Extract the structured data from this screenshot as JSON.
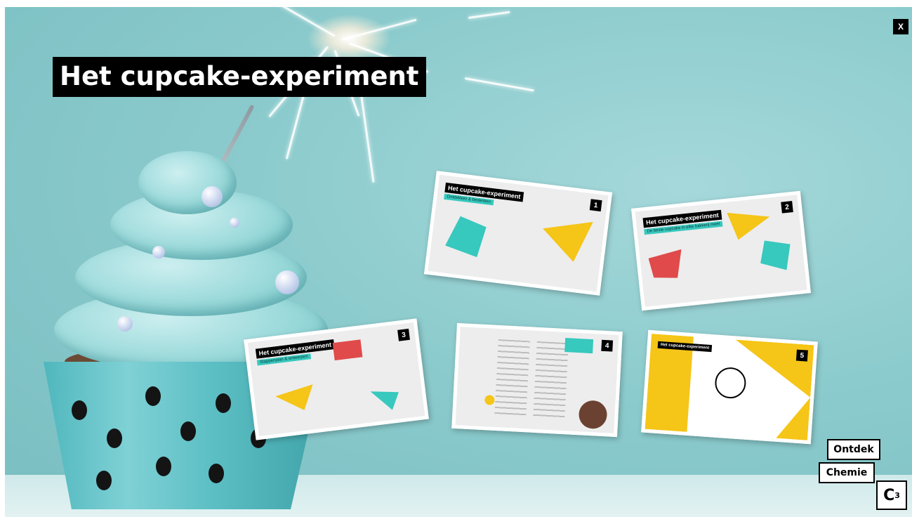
{
  "page": {
    "title": "Het cupcake-experiment"
  },
  "controls": {
    "close_label": "X"
  },
  "slides": [
    {
      "number": "1",
      "title": "Het cupcake-experiment",
      "subtitle": "Ontdekken & bedenken"
    },
    {
      "number": "2",
      "title": "Het cupcake-experiment",
      "subtitle": "De beste cupcake in elke bakkerij meet"
    },
    {
      "number": "3",
      "title": "Het cupcake-experiment",
      "subtitle": "Stappenplan & ontwerpen"
    },
    {
      "number": "4",
      "title": "",
      "subtitle": ""
    },
    {
      "number": "5",
      "title": "Het cupcake-experiment",
      "subtitle": ""
    }
  ],
  "logo": {
    "line1": "Ontdek",
    "line2": "Chemie",
    "line3": "C",
    "sup": "3"
  },
  "colors": {
    "accent_yellow": "#f5c518",
    "accent_teal": "#37c8be",
    "accent_red": "#e04a4a",
    "background": "#8ccbcd"
  }
}
